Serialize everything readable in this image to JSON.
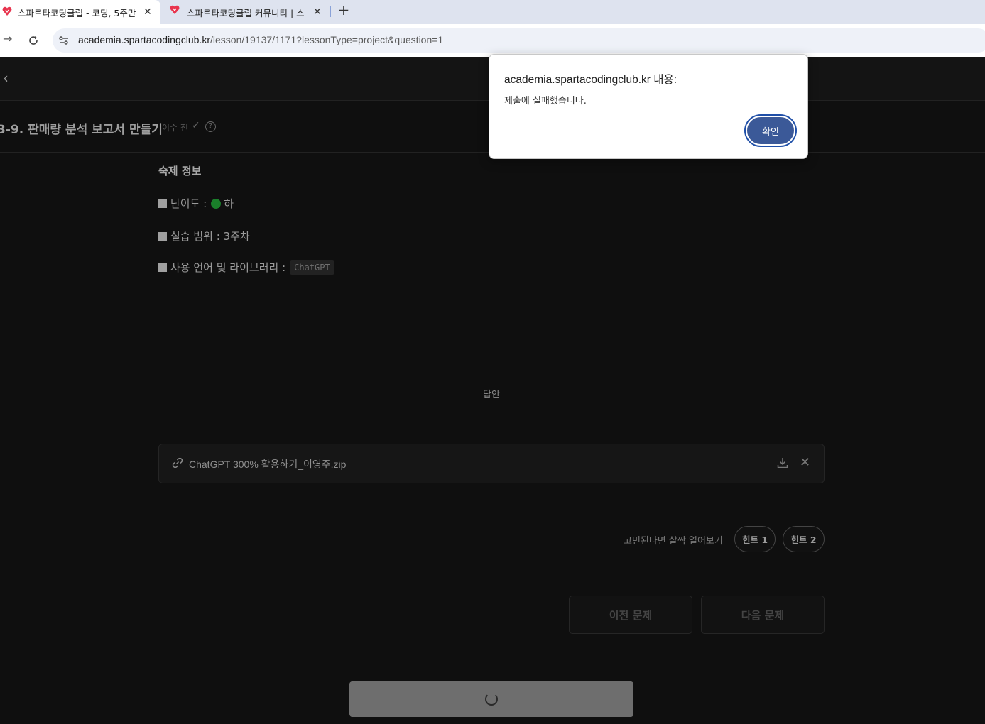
{
  "browser": {
    "tabs": [
      {
        "title": "스파르타코딩클럽 - 코딩, 5주만",
        "close": "✕"
      },
      {
        "title": "스파르타코딩클럽 커뮤니티 | 스",
        "close": "✕"
      }
    ],
    "new_tab": "+",
    "url_host": "academia.spartacodingclub.kr",
    "url_path": "/lesson/19137/1171?lessonType=project&question=1"
  },
  "lesson": {
    "title": "3-9. 판매량 분석 보고서 만들기",
    "status": "이수 전",
    "help": "?"
  },
  "homework": {
    "section_title": "숙제 정보",
    "difficulty_label": "난이도 :",
    "difficulty_value": "하",
    "range_label": "실습 범위 : 3주차",
    "lang_label": "사용 언어 및 라이브러리 :",
    "lang_chip": "ChatGPT"
  },
  "answer": {
    "divider_label": "답안",
    "file_name": "ChatGPT 300% 활용하기_이영주.zip"
  },
  "hints": {
    "prompt": "고민된다면 살짝 열어보기",
    "hint1": "힌트 1",
    "hint2": "힌트 2"
  },
  "navigation": {
    "prev": "이전 문제",
    "next": "다음 문제"
  },
  "dialog": {
    "title": "academia.spartacodingclub.kr 내용:",
    "message": "제출에 실패했습니다.",
    "ok": "확인"
  },
  "colors": {
    "accent_dialog_button": "#3b5998",
    "difficulty_easy": "#1a7f2a"
  }
}
